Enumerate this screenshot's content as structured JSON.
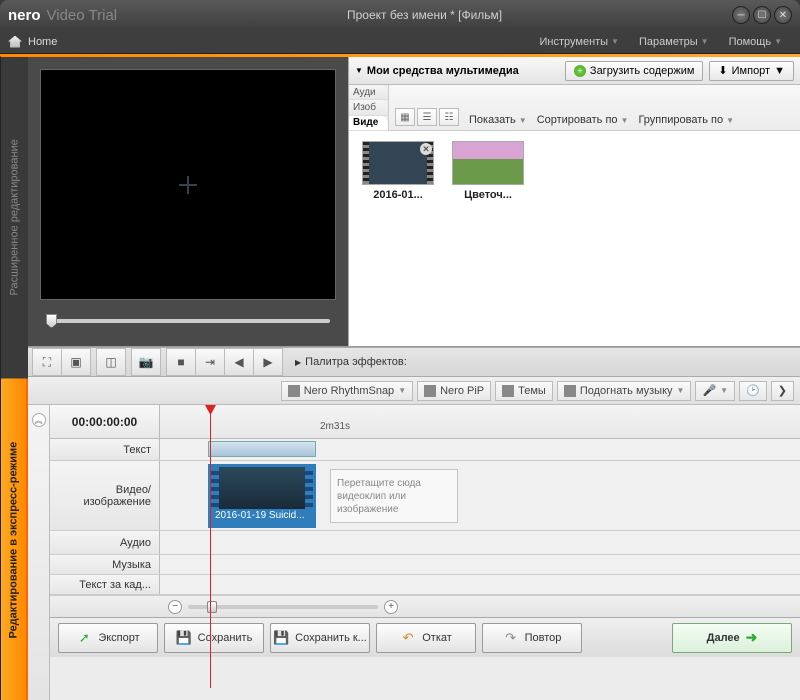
{
  "title": {
    "brand": "nero",
    "product": "Video Trial",
    "document": "Проект без имени * [Фильм]"
  },
  "homebar": {
    "home": "Home",
    "menus": [
      "Инструменты",
      "Параметры",
      "Помощь"
    ]
  },
  "side_tabs": {
    "advanced": "Расширенное редактирование",
    "express": "Редактирование в экспресс-режиме"
  },
  "media": {
    "title": "Мои средства мультимедиа",
    "load": "Загрузить содержим",
    "import": "Импорт",
    "subtabs": {
      "audio": "Ауди",
      "image": "Изоб",
      "video": "Виде"
    },
    "toolbar": {
      "show": "Показать",
      "sort": "Сортировать по",
      "group": "Группировать по"
    },
    "items": [
      {
        "label": "2016-01...",
        "kind": "video"
      },
      {
        "label": "Цветоч...",
        "kind": "image"
      }
    ]
  },
  "effects_palette": "Палитра эффектов:",
  "tools": {
    "rhythm": "Nero RhythmSnap",
    "pip": "Nero PiP",
    "themes": "Темы",
    "fit_music": "Подогнать музыку"
  },
  "timeline": {
    "timecode": "00:00:00:00",
    "ruler_mark": "2m31s",
    "tracks": {
      "text": "Текст",
      "video": "Видео/\nизображение",
      "audio": "Аудио",
      "music": "Музыка",
      "behind": "Текст за кад..."
    },
    "clip_name": "2016-01-19 Suicid...",
    "drop_hint": "Перетащите сюда видеоклип или изображение"
  },
  "bottom": {
    "export": "Экспорт",
    "save": "Сохранить",
    "saveas": "Сохранить к...",
    "undo": "Откат",
    "redo": "Повтор",
    "next": "Далее"
  }
}
